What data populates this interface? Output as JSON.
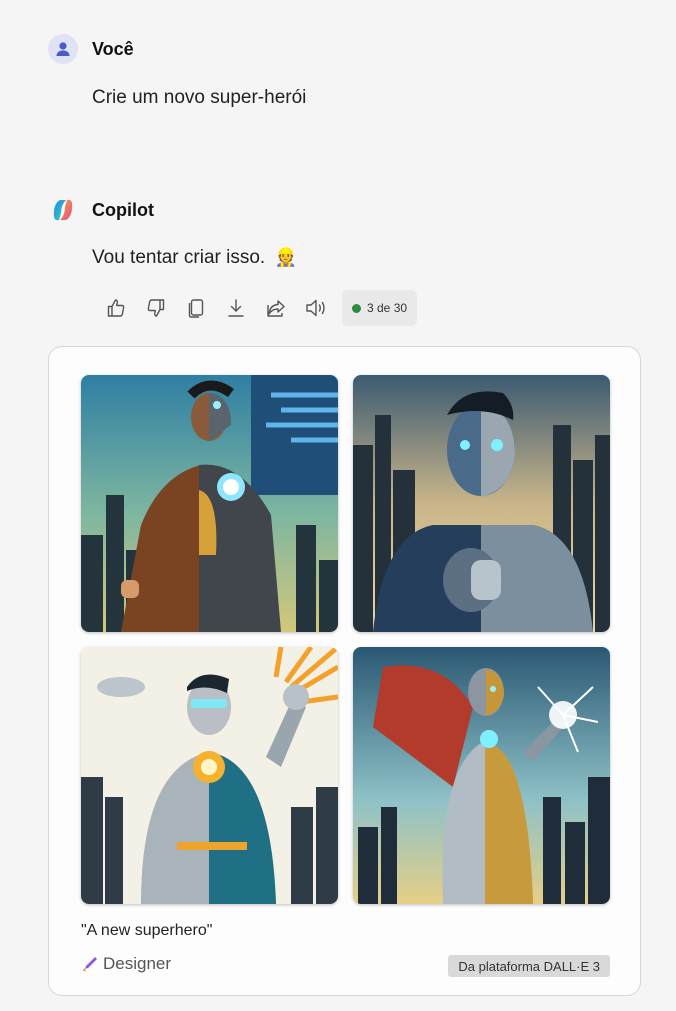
{
  "user": {
    "name": "Você",
    "message": "Crie um novo super-herói"
  },
  "copilot": {
    "name": "Copilot",
    "message": "Vou tentar criar isso.",
    "emoji": "👷"
  },
  "actions": {
    "icons": [
      "thumbs-up-icon",
      "thumbs-down-icon",
      "copy-icon",
      "download-icon",
      "share-icon",
      "speaker-icon"
    ],
    "counter": "3 de 30",
    "counter_color": "#2e8b3e"
  },
  "card": {
    "images": [
      {
        "name": "half-cyborg-brown-jacket"
      },
      {
        "name": "cyborg-face-city"
      },
      {
        "name": "cyborg-fist-energy"
      },
      {
        "name": "cyborg-cape-lightning"
      }
    ],
    "caption": "\"A new superhero\"",
    "designer_label": "Designer",
    "source_badge": "Da plataforma DALL·E 3"
  },
  "colors": {
    "background": "#f5f5f5",
    "accent": "#2e8b3e",
    "avatar_bg": "#dfe3f5"
  }
}
